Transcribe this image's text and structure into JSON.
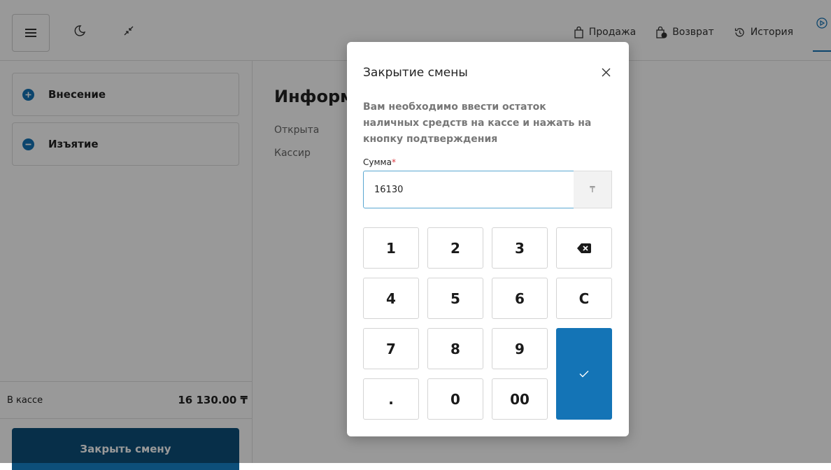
{
  "topbar": {
    "nav": [
      {
        "label": "Продажа",
        "icon": "shopping-bag-icon"
      },
      {
        "label": "Возврат",
        "icon": "return-bag-icon"
      },
      {
        "label": "История",
        "icon": "history-icon"
      }
    ],
    "last_icon": "shift-icon"
  },
  "sidebar": {
    "actions": [
      {
        "label": "Внесение",
        "icon": "plus-circle-icon"
      },
      {
        "label": "Изъятие",
        "icon": "minus-circle-icon"
      }
    ],
    "cash_label": "В кассе",
    "cash_value": "16 130.00 ₸",
    "close_shift_label": "Закрыть смену"
  },
  "main": {
    "title": "Информа",
    "rows": [
      "Открыта",
      "Кассир"
    ]
  },
  "modal": {
    "title": "Закрытие смены",
    "description": "Вам необходимо ввести остаток наличных средств на кассе и нажать на кнопку подтверждения",
    "field_label": "Сумма",
    "required_mark": "*",
    "sum_value": "16130",
    "currency": "₸",
    "keys": [
      "1",
      "2",
      "3",
      "4",
      "5",
      "6",
      "C",
      "7",
      "8",
      "9",
      ".",
      "0",
      "00"
    ],
    "accent_color": "#1474b6"
  }
}
